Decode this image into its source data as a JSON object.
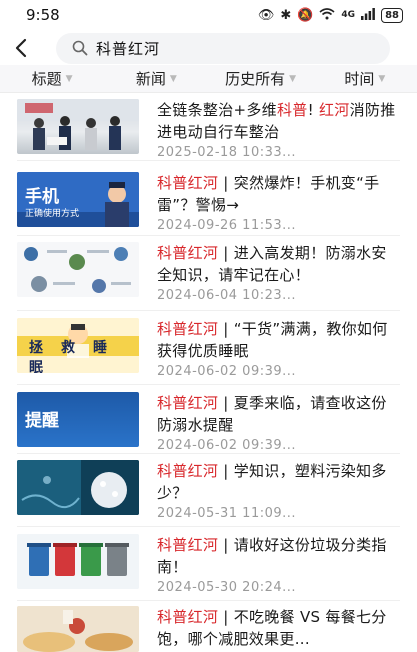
{
  "status": {
    "time": "9:58",
    "signal": "4G",
    "battery": "88"
  },
  "search": {
    "query": "科普红河"
  },
  "filters": [
    {
      "label": "标题"
    },
    {
      "label": "新闻"
    },
    {
      "label": "历史所有"
    },
    {
      "label": "时间"
    }
  ],
  "results": [
    {
      "pre": "全链条整治+多维",
      "hl": "科普",
      "mid": "! ",
      "hl2": "红河",
      "post": "消防推进电动自行车整治",
      "date": "2025-02-18 10:33..."
    },
    {
      "pre": "",
      "hl": "科普红河",
      "mid": "",
      "hl2": "",
      "post": " | 突然爆炸！手机变“手雷”？警惕→",
      "date": "2024-09-26 11:53...",
      "thumb_text": "手机",
      "thumb_sub": "正确使用方式"
    },
    {
      "pre": "",
      "hl": "科普红河",
      "mid": "",
      "hl2": "",
      "post": " | 进入高发期！防溺水安全知识，请牢记在心！",
      "date": "2024-06-04 10:23..."
    },
    {
      "pre": "",
      "hl": "科普红河",
      "mid": "",
      "hl2": "",
      "post": " | “干货”满满，教你如何获得优质睡眠",
      "date": "2024-06-02 09:39...",
      "thumb_text": "拯救睡眠"
    },
    {
      "pre": "",
      "hl": "科普红河",
      "mid": "",
      "hl2": "",
      "post": " | 夏季来临，请查收这份防溺水提醒",
      "date": "2024-06-02 09:39...",
      "thumb_text": "提醒"
    },
    {
      "pre": "",
      "hl": "科普红河",
      "mid": "",
      "hl2": "",
      "post": " | 学知识，塑料污染知多少？",
      "date": "2024-05-31 11:09..."
    },
    {
      "pre": "",
      "hl": "科普红河",
      "mid": "",
      "hl2": "",
      "post": " | 请收好这份垃圾分类指南！",
      "date": "2024-05-30 20:24..."
    },
    {
      "pre": "",
      "hl": "科普红河",
      "mid": "",
      "hl2": "",
      "post": " | 不吃晚餐 VS 每餐七分饱，哪个减肥效果更...",
      "date": "2024-05-30 20:24..."
    }
  ],
  "colors": {
    "highlight": "#d8282c",
    "date": "#9a9a9a",
    "filter_bg": "#f7f7f9",
    "search_bg": "#f3f4f6"
  }
}
